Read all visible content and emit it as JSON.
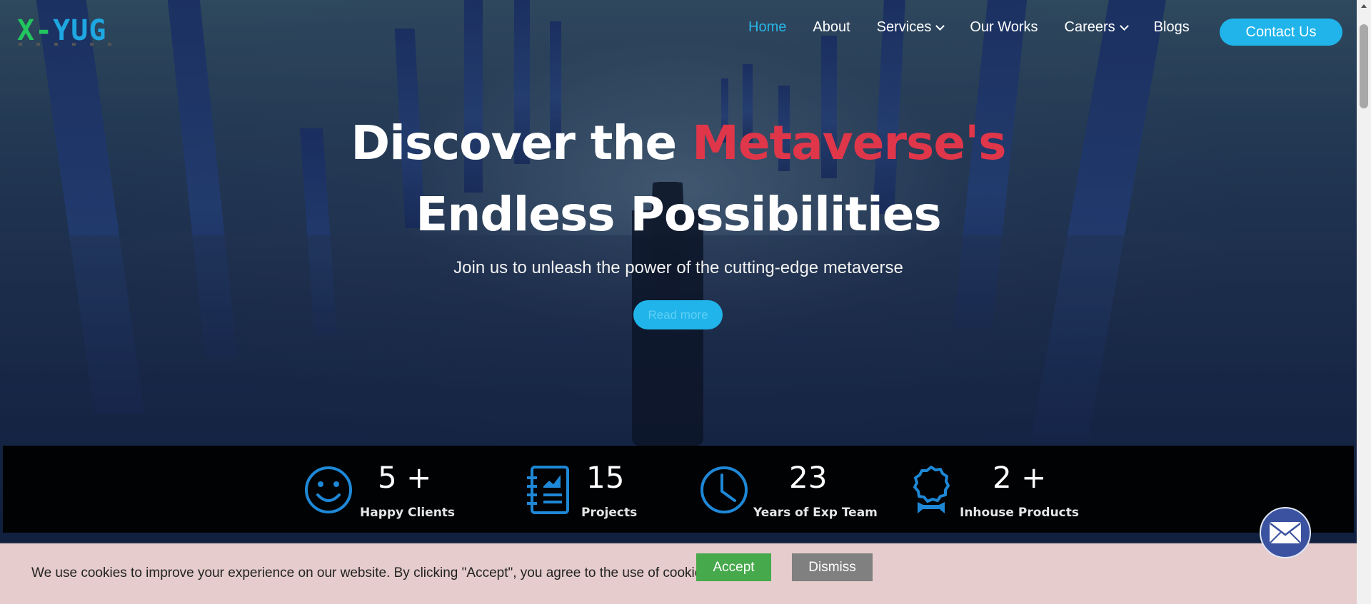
{
  "brand": {
    "logo_x": "X-",
    "logo_rest": "YUG"
  },
  "nav": {
    "items": [
      {
        "label": "Home",
        "active": true
      },
      {
        "label": "About"
      },
      {
        "label": "Services",
        "dropdown": true
      },
      {
        "label": "Our Works"
      },
      {
        "label": "Careers",
        "dropdown": true
      },
      {
        "label": "Blogs"
      }
    ],
    "contact_label": "Contact Us"
  },
  "hero": {
    "line1_white": "Discover the ",
    "line1_red": "Metaverse's",
    "line2": "Endless Possibilities",
    "subtitle": "Join us to unleash the power of the cutting-edge metaverse",
    "cta_label": "Read more"
  },
  "stats": [
    {
      "icon": "smiley-icon",
      "value": "5 +",
      "label": "Happy Clients"
    },
    {
      "icon": "notebook-chart-icon",
      "value": "15",
      "label": "Projects"
    },
    {
      "icon": "clock-icon",
      "value": "23",
      "label": "Years of Exp Team"
    },
    {
      "icon": "award-badge-icon",
      "value": "2 +",
      "label": "Inhouse Products"
    }
  ],
  "cookie": {
    "message": "We use cookies to improve your experience on our website. By clicking \"Accept\", you agree to the use of cookies.",
    "accept_label": "Accept",
    "dismiss_label": "Dismiss"
  },
  "colors": {
    "accent": "#20b4ea",
    "headline_red": "#e0364a",
    "cookie_bg": "#e6cccc",
    "accept_green": "#46a94b",
    "dismiss_gray": "#808080",
    "icon_blue": "#1e88d6"
  }
}
